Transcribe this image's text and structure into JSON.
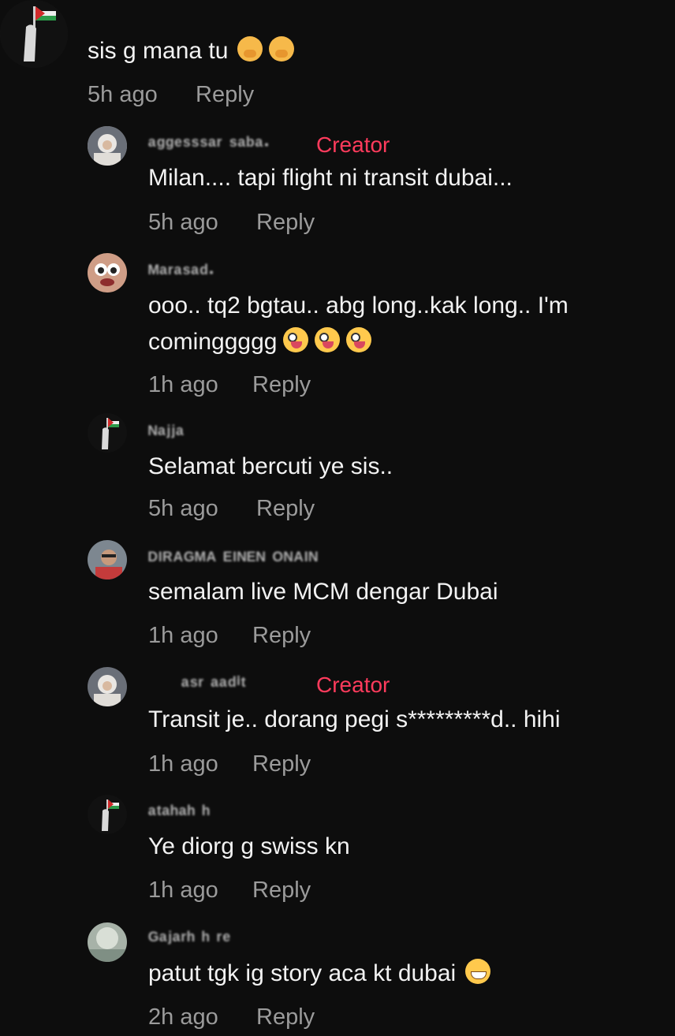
{
  "comments": [
    {
      "username": "",
      "creator_label": "",
      "text": "sis g mana tu",
      "emoji": [
        "face-with-hand-over-mouth",
        "face-with-hand-over-mouth"
      ],
      "time": "5h ago",
      "reply": "Reply"
    },
    {
      "username": "ᵃᵍᵍᵉˢˢˢᵃʳ ˢᵃᵇᵃ·",
      "creator_label": "Creator",
      "text": "Milan.... tapi flight ni transit dubai...",
      "emoji": [],
      "time": "5h ago",
      "reply": "Reply"
    },
    {
      "username": "ᴹᵃʳᵃˢᵃᵈ·",
      "creator_label": "",
      "text": "ooo.. tq2 bgtau.. abg long..kak long.. I'm",
      "text2": "cominggggg",
      "emoji": [
        "zany-face",
        "zany-face",
        "zany-face"
      ],
      "time": "1h ago",
      "reply": "Reply"
    },
    {
      "username": "ᴺᵃʲʲᵃ",
      "creator_label": "",
      "text": "Selamat bercuti ye sis..",
      "emoji": [],
      "time": "5h ago",
      "reply": "Reply"
    },
    {
      "username": "ᴰᴵᴿᴬᴳᴹᴬ ᴱᴵᴺᴱᴺ ᴼᴺᴬᴵᴺ",
      "creator_label": "",
      "text": "semalam live MCM dengar Dubai",
      "emoji": [],
      "time": "1h ago",
      "reply": "Reply"
    },
    {
      "username": "ᵃˢʳ ᵃᵃᵈⁱᵗ",
      "creator_label": "Creator",
      "text": "Transit je.. dorang pegi s*********d.. hihi",
      "emoji": [],
      "time": "1h ago",
      "reply": "Reply"
    },
    {
      "username": "ᵃᵗᵃʰᵃʰ ʰ",
      "creator_label": "",
      "text": "Ye diorg g swiss kn",
      "emoji": [],
      "time": "1h ago",
      "reply": "Reply"
    },
    {
      "username": "ᴳᵃʲᵃʳʰ ʰ ʳᵉ",
      "creator_label": "",
      "text": "patut tgk ig story aca kt dubai",
      "emoji": [
        "grinning-face-with-sweat"
      ],
      "time": "2h ago",
      "reply": "Reply"
    }
  ],
  "colors": {
    "background": "#0d0d0d",
    "creator": "#ff3b5c",
    "meta": "#9b9b9b",
    "text": "#f2f2f2"
  }
}
